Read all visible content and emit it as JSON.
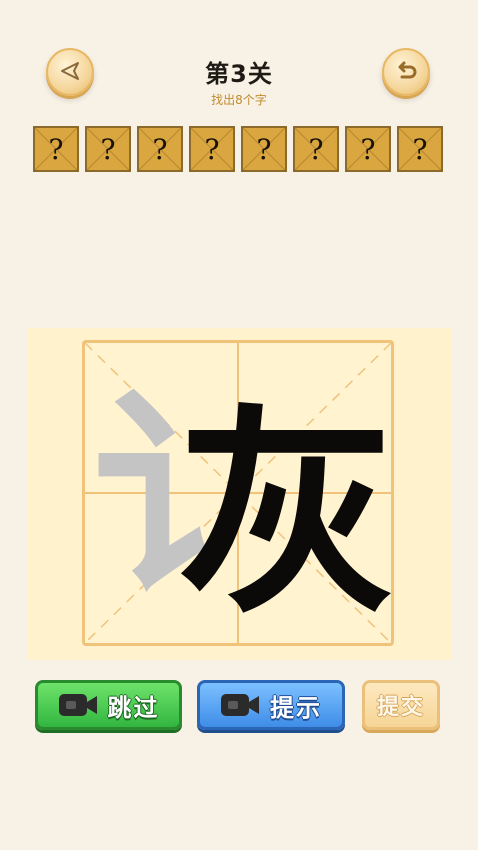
{
  "header": {
    "title": "第3关",
    "subtitle": "找出8个字"
  },
  "icons": {
    "back": "back-triangle-icon",
    "restart": "restart-arrow-icon",
    "video": "video-camera-icon"
  },
  "slots": [
    "?",
    "?",
    "?",
    "?",
    "?",
    "?",
    "?",
    "?"
  ],
  "board": {
    "character": "诙",
    "gray_part": "讠",
    "black_part": "灰"
  },
  "buttons": {
    "skip_label": "跳过",
    "hint_label": "提示",
    "submit_label": "提交"
  },
  "colors": {
    "background": "#f8f2e6",
    "slot_fill": "#d9a640",
    "board_fill": "#fff2cc",
    "grid_line": "#f0c27a",
    "skip_green": "#32b640",
    "hint_blue": "#3f8de8",
    "submit_beige": "#f6d596",
    "subtitle_gold": "#c08a2c"
  }
}
